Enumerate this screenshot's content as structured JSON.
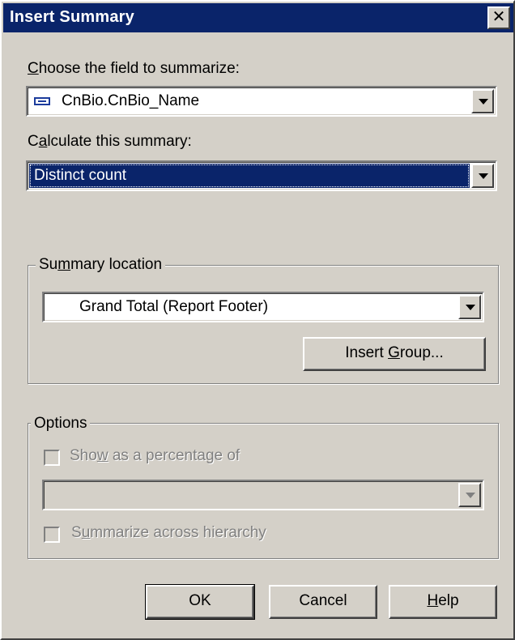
{
  "window": {
    "title": "Insert Summary",
    "close_glyph": "✕"
  },
  "field": {
    "label": "Choose the field to summarize:",
    "label_accel": "C",
    "label_rest": "hoose the field to summarize:",
    "value": "CnBio.CnBio_Name",
    "icon": "database-field-icon"
  },
  "calc": {
    "label_pre": "C",
    "label_accel": "a",
    "label_rest": "lculate this summary:",
    "value": "Distinct count"
  },
  "location": {
    "legend_pre": "Su",
    "legend_accel": "m",
    "legend_rest": "mary location",
    "value": "Grand Total (Report Footer)",
    "insert_group_pre": "Insert ",
    "insert_group_accel": "G",
    "insert_group_rest": "roup..."
  },
  "options": {
    "legend": "Options",
    "percent_pre": "Sho",
    "percent_accel": "w",
    "percent_rest": " as a percentage of",
    "percent_value": "",
    "hierarchy_pre": "S",
    "hierarchy_accel": "u",
    "hierarchy_rest": "mmarize across hierarchy"
  },
  "buttons": {
    "ok": "OK",
    "cancel": "Cancel",
    "help_accel": "H",
    "help_rest": "elp"
  },
  "colors": {
    "titlebar": "#0a246a",
    "face": "#d4d0c8",
    "selection": "#0a246a"
  }
}
